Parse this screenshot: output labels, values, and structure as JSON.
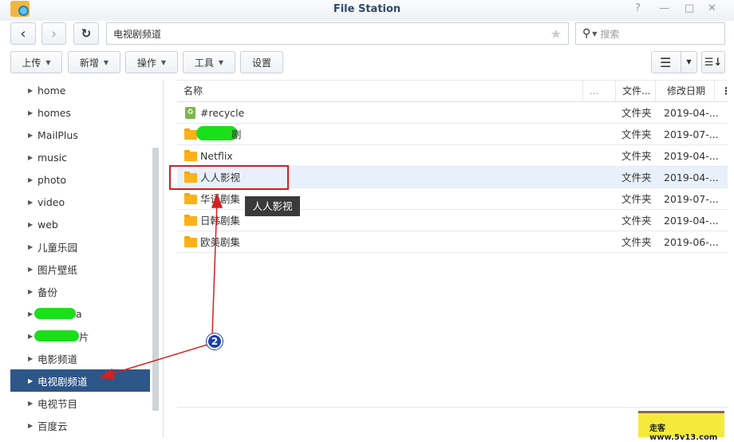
{
  "window": {
    "title": "File Station",
    "help": "?",
    "minimize": "—",
    "maximize": "□",
    "close": "✕"
  },
  "nav": {
    "back": "‹",
    "forward": "›",
    "refresh": "↻",
    "path": "电视剧频道",
    "favorite": "★",
    "search_placeholder": "搜索"
  },
  "toolbar": {
    "upload": "上传",
    "create": "新增",
    "action": "操作",
    "tools": "工具",
    "settings": "设置"
  },
  "sidebar": {
    "items": [
      {
        "label": "home"
      },
      {
        "label": "homes"
      },
      {
        "label": "MailPlus"
      },
      {
        "label": "music"
      },
      {
        "label": "photo"
      },
      {
        "label": "video"
      },
      {
        "label": "web"
      },
      {
        "label": "儿童乐园"
      },
      {
        "label": "图片壁纸"
      },
      {
        "label": "备份"
      },
      {
        "label": "a"
      },
      {
        "label": "片"
      },
      {
        "label": "电影频道"
      },
      {
        "label": "电视剧频道",
        "selected": true
      },
      {
        "label": "电视节目"
      },
      {
        "label": "百度云"
      }
    ]
  },
  "columns": {
    "name": "名称",
    "size": "...",
    "type": "文件...",
    "modified": "修改日期",
    "menu": "⋮"
  },
  "files": [
    {
      "name": "#recycle",
      "type": "文件夹",
      "modified": "2019-04-...",
      "icon": "recycle-bin-icon"
    },
    {
      "name": "剧",
      "type": "文件夹",
      "modified": "2019-07-...",
      "icon": "folder-icon"
    },
    {
      "name": "Netflix",
      "type": "文件夹",
      "modified": "2019-04-...",
      "icon": "folder-icon"
    },
    {
      "name": "人人影视",
      "type": "文件夹",
      "modified": "2019-04-...",
      "icon": "folder-icon",
      "highlighted": true
    },
    {
      "name": "华语剧集",
      "type": "文件夹",
      "modified": "2019-07-...",
      "icon": "folder-icon"
    },
    {
      "name": "日韩剧集",
      "type": "文件夹",
      "modified": "2019-04-...",
      "icon": "folder-icon"
    },
    {
      "name": "欧美剧集",
      "type": "文件夹",
      "modified": "2019-06-...",
      "icon": "folder-icon"
    }
  ],
  "tooltip": "人人影视",
  "annotation": {
    "step": "2",
    "color": "#d42020"
  },
  "watermark": "走客 www.5v13.com",
  "colors": {
    "selected": "#2d5689",
    "title": "#2f4a6a",
    "folder": "#fbb11a"
  }
}
